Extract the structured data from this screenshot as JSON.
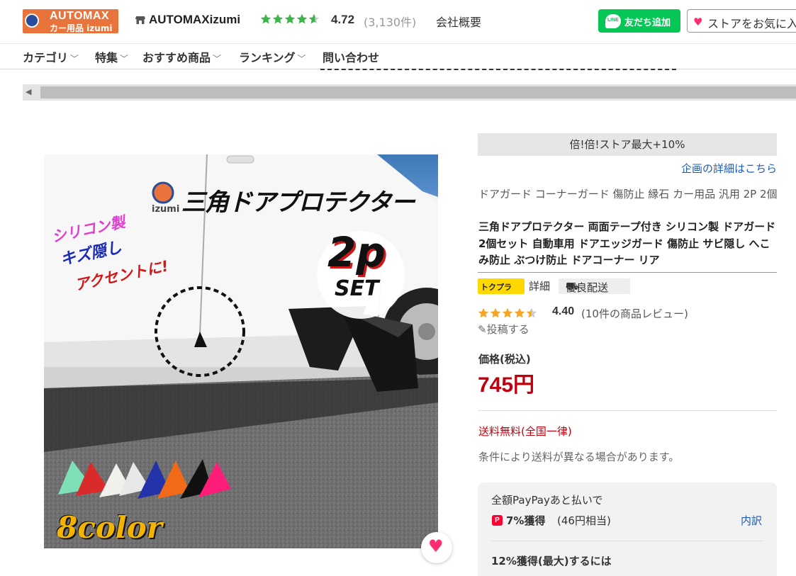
{
  "header": {
    "logo_line1": "AUTOMAX",
    "logo_line2": "カー用品 izumi",
    "store_name": "AUTOMAXizumi",
    "rating": "4.72",
    "rating_count": "(3,130件)",
    "company_link": "会社概要",
    "line_button": "友だち追加",
    "line_icon_text": "LINE",
    "favorite_button": "ストアをお気に入り",
    "star_color": "#3cb54a"
  },
  "nav": {
    "items": [
      "カテゴリ",
      "特集",
      "おすすめ商品",
      "ランキング",
      "問い合わせ"
    ]
  },
  "product_image": {
    "title": "三角ドアプロテクター",
    "brand": "izumi",
    "tagline1": "シリコン製",
    "tagline2": "キズ隠し",
    "tagline3": "アクセントに!",
    "badge_2p": "2p",
    "badge_set": "SET",
    "color_count": "8color",
    "swatches": [
      "#7fe0b8",
      "#d92b2b",
      "#f2f0ea",
      "#e8e8e8",
      "#2433a8",
      "#f06a1a",
      "#111111",
      "#ff1d7a"
    ]
  },
  "info": {
    "promo": "倍!倍!ストア最大+10%",
    "promo_link": "企画の詳細はこちら",
    "sub_title": "ドアガード コーナーガード 傷防止 縁石 カー用品 汎用 2P 2個",
    "main_title": "三角ドアプロテクター 両面テープ付き シリコン製 ドアガード 2個セット 自動車用 ドアエッジガード 傷防止 サビ隠し へこみ防止 ぶつけ防止 ドアコーナー リア",
    "tokupura_label": "トクプラ",
    "tokupura_detail": "詳細",
    "good_shipping": "優良配送",
    "rating": "4.40",
    "review_count": "(10件の商品レビュー)",
    "post_review": "投稿する",
    "price_label": "価格(税込)",
    "price": "745円",
    "free_shipping": "送料無料(全国一律)",
    "shipping_note": "条件により送料が異なる場合があります。",
    "price_color": "#c0000e"
  },
  "paypay": {
    "title": "全額PayPayあと払いで",
    "icon": "P",
    "rate": "7%獲得",
    "rate_sub": "(46円相当)",
    "detail_link": "内訳",
    "max_text": "12%獲得(最大)するには"
  }
}
